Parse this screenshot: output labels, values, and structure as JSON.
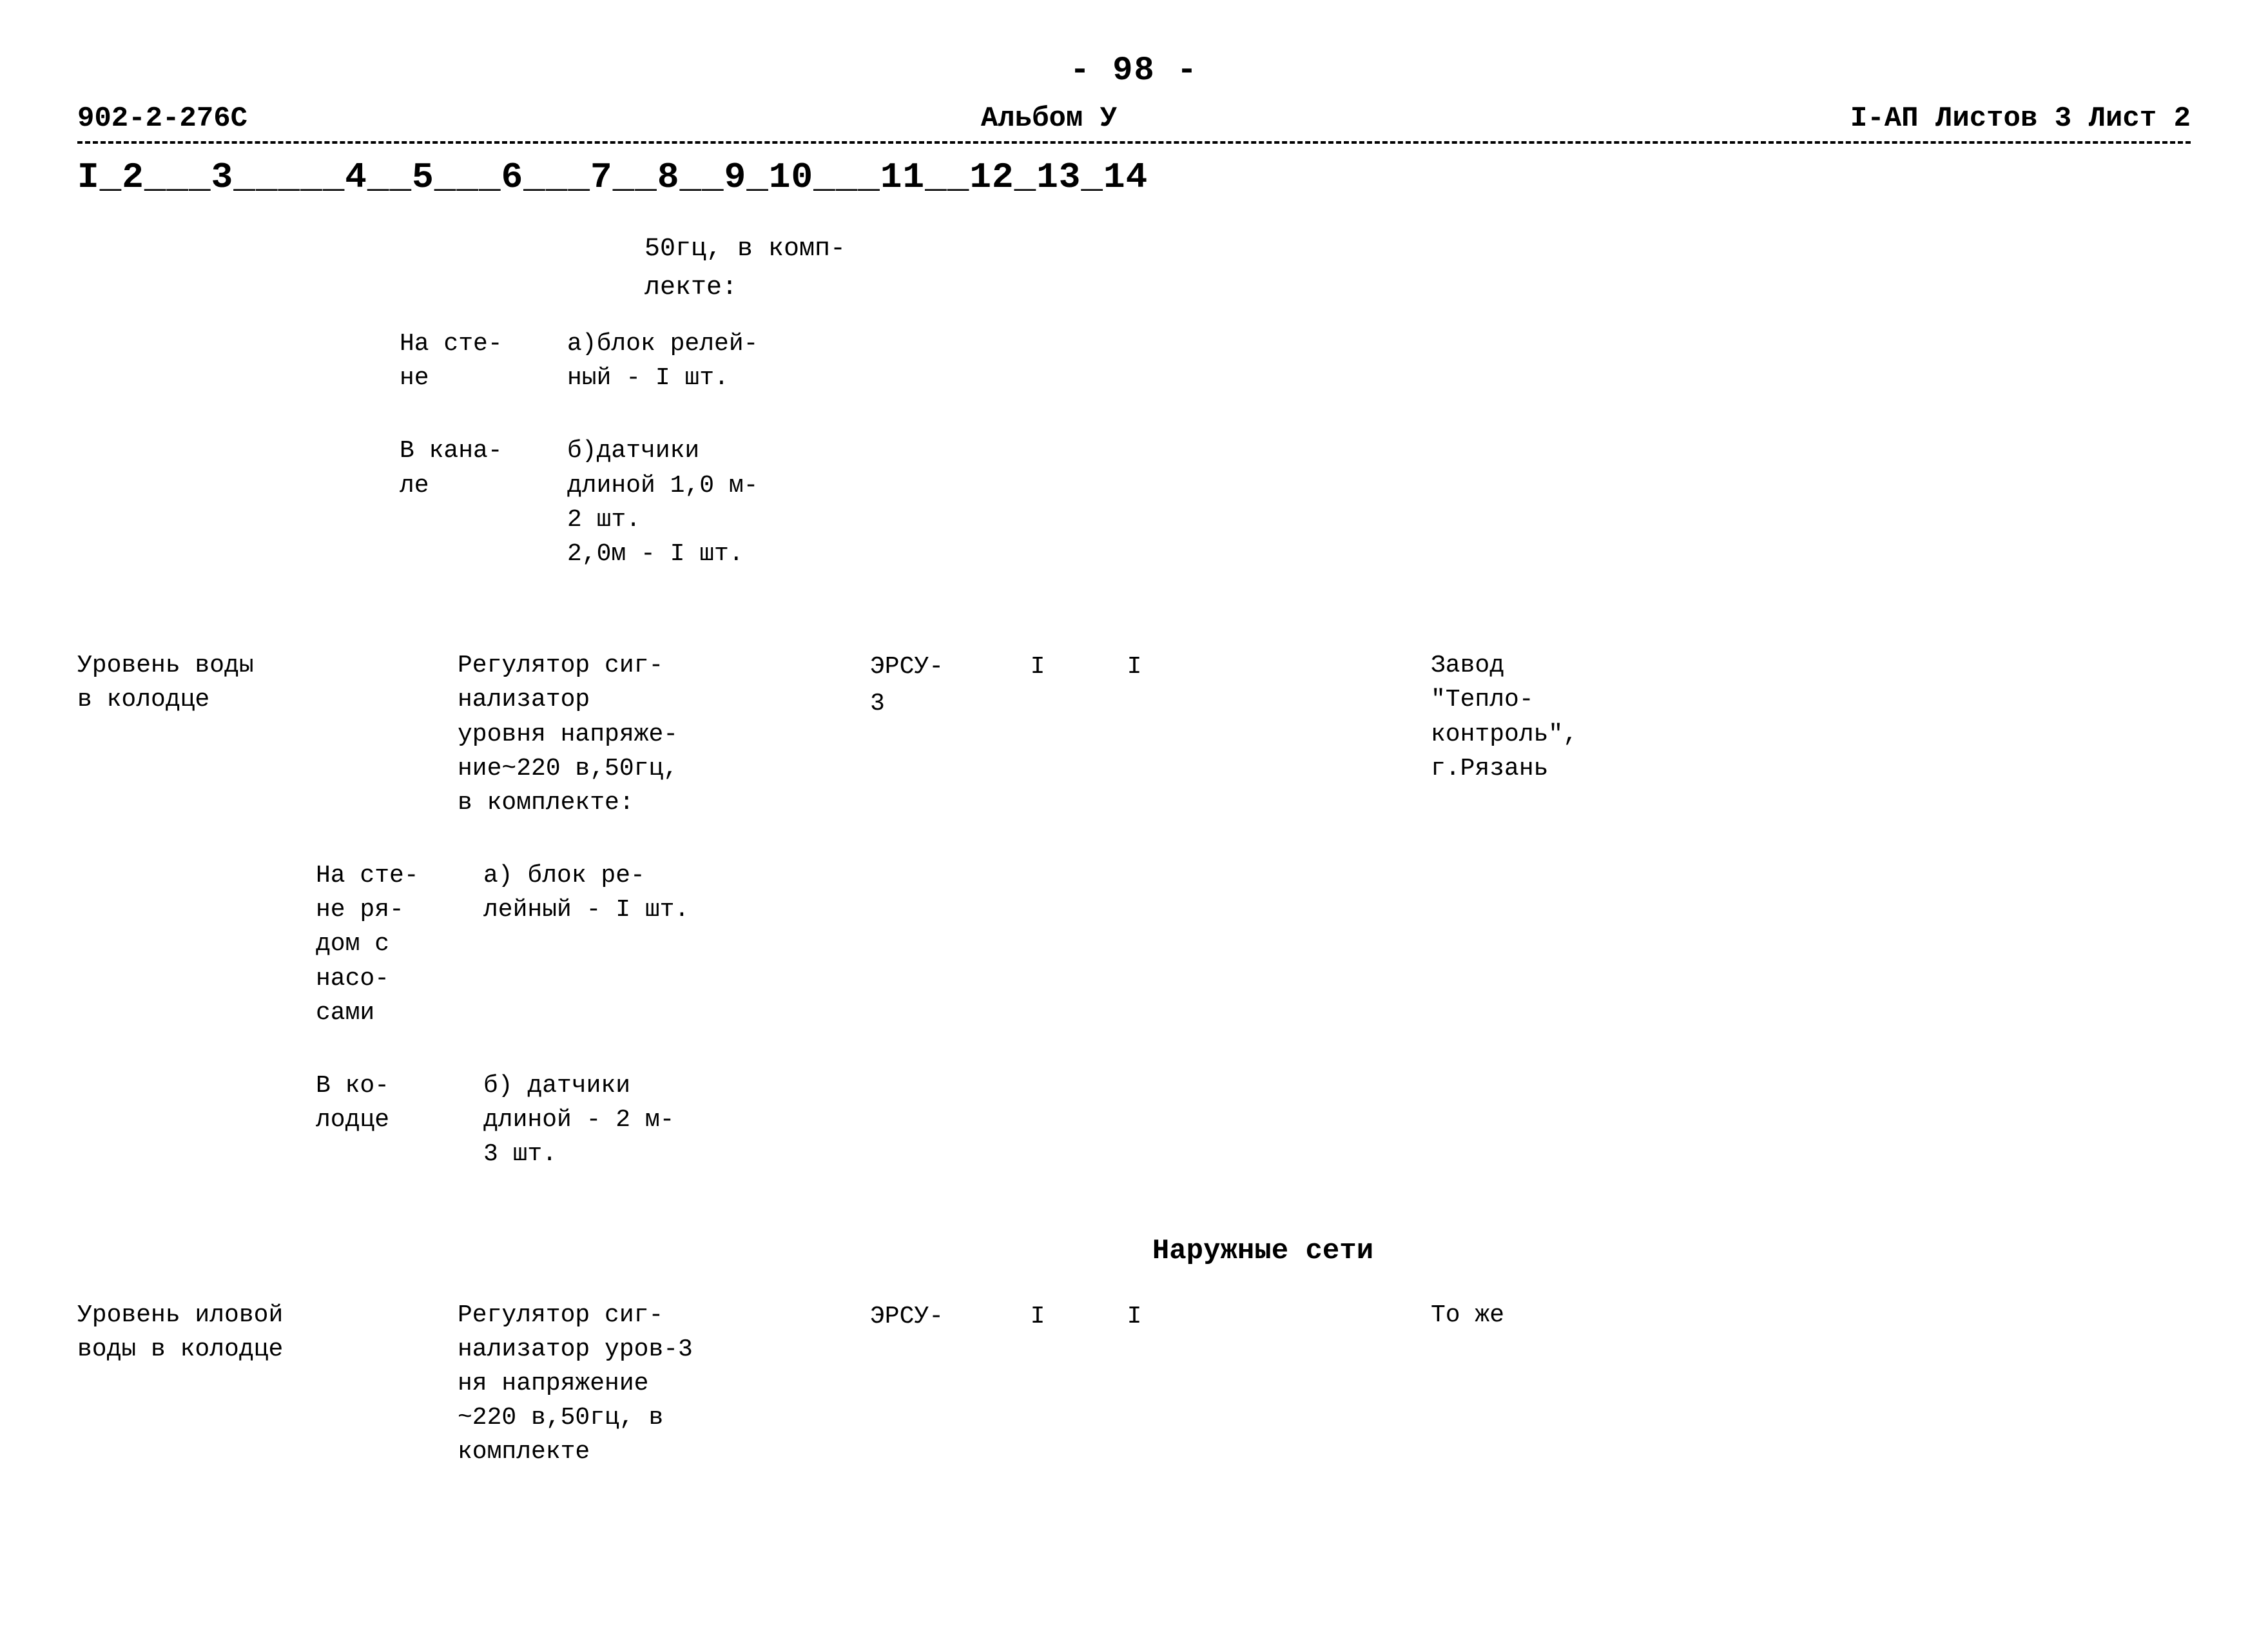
{
  "header": {
    "page_number": "- 98 -",
    "doc_code": "902-2-276С",
    "album_label": "Альбом У",
    "sheet_info": "I-АП  Листов 3  Лист 2"
  },
  "columns": {
    "col1": "I",
    "col2": "2",
    "col3": "3",
    "col4": "4",
    "col5": "5",
    "col6": "6",
    "col7": "7",
    "col8": "8",
    "col9": "9",
    "col10": "10",
    "col11": "11",
    "col12": "12",
    "col13": "13",
    "col14": "14"
  },
  "content": {
    "row1": {
      "freq_desc": "50гц, в комп-\nлекте:"
    },
    "row2": {
      "place": "На сте-\nне",
      "desc": "а)блок релей-\nный - I шт."
    },
    "row3": {
      "place": "В кана-\nле",
      "desc": "б)датчики\nдлиной 1,0 м-\n2 шт.\n2,0м - I шт."
    },
    "row4": {
      "param": "Уровень воды\nв колодце",
      "device_name": "Регулятор сиг-\nнализатор\nуровня напряже-\nние~220 в,50гц,\nв комплекте:",
      "device_code": "ЭРСУ-\n3",
      "qty1": "I",
      "qty2": "I",
      "manufacturer": "Завод\n\"Тепло-\nконтроль\",\nг.Рязань"
    },
    "row5": {
      "place": "На сте-\nне ря-\nдом с\nнасо-\nсами",
      "desc": "а) блок ре-\nлейный - I шт."
    },
    "row6": {
      "place": "В ко-\nлодце",
      "desc": "б) датчики\nдлиной - 2 м-\n3 шт."
    },
    "section_title": "Наружные сети",
    "row7": {
      "param": "Уровень иловой\nводы в колодце",
      "device_name": "Регулятор сиг-\nнализатор уров-3\nня напряжение\n~220 в,50гц, в\nкомплекте",
      "device_code": "ЭРСУ-",
      "qty1": "I",
      "qty2": "I",
      "manufacturer": "То же"
    }
  }
}
